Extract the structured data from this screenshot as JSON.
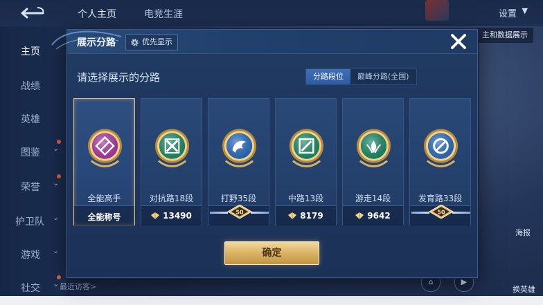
{
  "background": {
    "tabs": [
      "个人主页",
      "电竞生涯"
    ],
    "settings_label": "设置",
    "hint_text": "主和数据展示",
    "sidebar": [
      {
        "label": "主页",
        "active": true,
        "chevron": false,
        "dot": false
      },
      {
        "label": "战绩",
        "active": false,
        "chevron": false,
        "dot": false
      },
      {
        "label": "英雄",
        "active": false,
        "chevron": false,
        "dot": false
      },
      {
        "label": "图鉴",
        "active": false,
        "chevron": true,
        "dot": true
      },
      {
        "label": "荣誉",
        "active": false,
        "chevron": true,
        "dot": true
      },
      {
        "label": "护卫队",
        "active": false,
        "chevron": true,
        "dot": false
      },
      {
        "label": "游戏",
        "active": false,
        "chevron": true,
        "dot": false
      },
      {
        "label": "社交",
        "active": false,
        "chevron": true,
        "dot": true
      }
    ],
    "visitors_label": "最近访客>",
    "right_label_1": "海报",
    "right_label_2": "换英雄"
  },
  "modal": {
    "title": "展示分路",
    "priority_button": "优先显示",
    "subtitle": "请选择展示的分路",
    "toggle": [
      {
        "label": "分路段位",
        "active": true
      },
      {
        "label": "巅峰分路(全国)",
        "active": false
      }
    ],
    "cards": [
      {
        "name": "全能高手",
        "selected": true,
        "footer_type": "title",
        "footer_text": "全能称号",
        "badge_color": "#b23aa8",
        "icon": "allround-icon"
      },
      {
        "name": "对抗路18段",
        "selected": false,
        "footer_type": "points",
        "footer_text": "13490",
        "badge_color": "#1d8f6a",
        "icon": "clash-lane-icon"
      },
      {
        "name": "打野35段",
        "selected": false,
        "footer_type": "tier",
        "footer_text": "50",
        "badge_color": "#2a6fc4",
        "icon": "jungle-icon"
      },
      {
        "name": "中路13段",
        "selected": false,
        "footer_type": "points",
        "footer_text": "8179",
        "badge_color": "#1d8f6a",
        "icon": "mid-lane-icon"
      },
      {
        "name": "游走14段",
        "selected": false,
        "footer_type": "points",
        "footer_text": "9642",
        "badge_color": "#1d8f6a",
        "icon": "roam-icon"
      },
      {
        "name": "发育路33段",
        "selected": false,
        "footer_type": "tier",
        "footer_text": "50",
        "badge_color": "#2a6fc4",
        "icon": "farm-lane-icon"
      }
    ],
    "confirm_label": "确定"
  },
  "colors": {
    "accent_gold": "#e6c27a",
    "panel_bg": "#213b63",
    "toggle_active": "#3e6fb8"
  }
}
